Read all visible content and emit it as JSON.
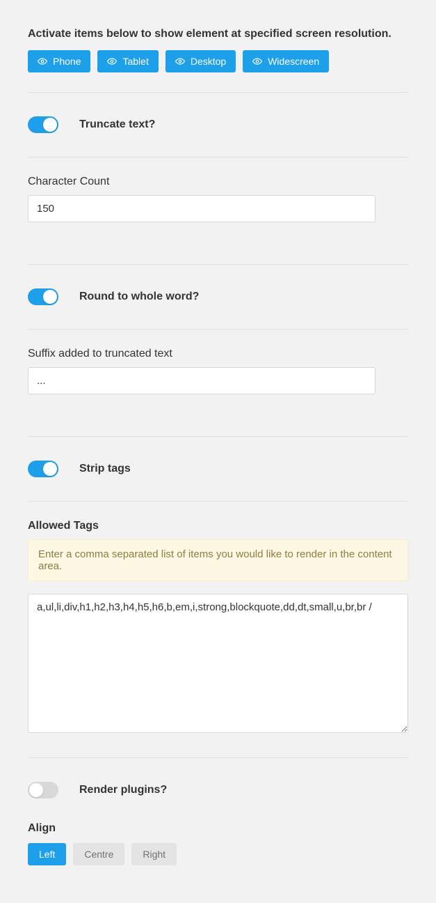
{
  "header": {
    "instruction": "Activate items below to show element at specified screen resolution."
  },
  "resolutionButtons": [
    {
      "label": "Phone"
    },
    {
      "label": "Tablet"
    },
    {
      "label": "Desktop"
    },
    {
      "label": "Widescreen"
    }
  ],
  "toggles": {
    "truncate": {
      "label": "Truncate text?",
      "value": true
    },
    "roundWord": {
      "label": "Round to whole word?",
      "value": true
    },
    "stripTags": {
      "label": "Strip tags",
      "value": true
    },
    "renderPlug": {
      "label": "Render plugins?",
      "value": false
    }
  },
  "fields": {
    "characterCount": {
      "label": "Character Count",
      "value": "150"
    },
    "suffix": {
      "label": "Suffix added to truncated text",
      "value": "..."
    },
    "allowedTags": {
      "label": "Allowed Tags",
      "hint": "Enter a comma separated list of items you would like to render in the content area.",
      "value": "a,ul,li,div,h1,h2,h3,h4,h5,h6,b,em,i,strong,blockquote,dd,dt,small,u,br,br /"
    }
  },
  "align": {
    "label": "Align",
    "options": [
      "Left",
      "Centre",
      "Right"
    ],
    "selected": "Left"
  }
}
